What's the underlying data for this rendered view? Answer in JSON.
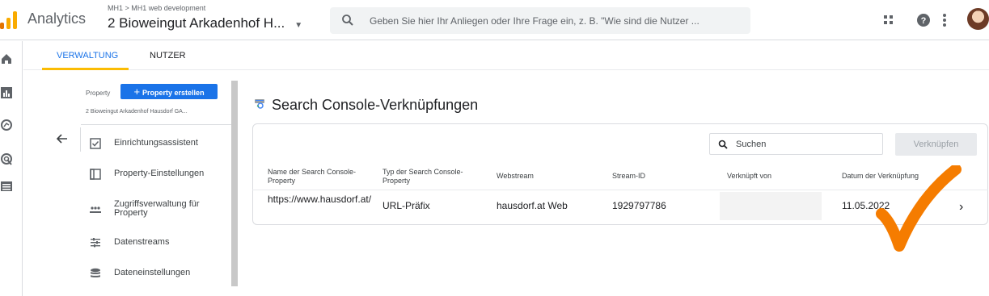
{
  "header": {
    "app_name": "Analytics",
    "breadcrumb": "MH1 > MH1 web development",
    "account_name": "2 Bioweingut Arkadenhof H...",
    "search_placeholder": "Geben Sie hier Ihr Anliegen oder Ihre Frage ein, z. B. \"Wie sind die Nutzer ..."
  },
  "tabs": [
    {
      "label": "VERWALTUNG",
      "active": true
    },
    {
      "label": "NUTZER",
      "active": false
    }
  ],
  "property_panel": {
    "label": "Property",
    "create_button": "Property erstellen",
    "property_name": "2 Bioweingut Arkadenhof Hausdorf GA...",
    "items": [
      {
        "label": "Einrichtungsassistent",
        "icon": "checkbox-icon"
      },
      {
        "label": "Property-Einstellungen",
        "icon": "settings-square-icon"
      },
      {
        "label": "Zugriffsverwaltung für Property",
        "icon": "people-icon"
      },
      {
        "label": "Datenstreams",
        "icon": "streams-icon"
      },
      {
        "label": "Dateneinstellungen",
        "icon": "database-icon"
      }
    ]
  },
  "main": {
    "title": "Search Console-Verknüpfungen",
    "search_placeholder": "Suchen",
    "link_button": "Verknüpfen",
    "columns": [
      "Name der Search Console-Property",
      "Typ der Search Console-Property",
      "Webstream",
      "Stream-ID",
      "Verknüpft von",
      "Datum der Verknüpfung"
    ],
    "rows": [
      {
        "property": "https://www.hausdorf.at/",
        "type": "URL-Präfix",
        "webstream": "hausdorf.at Web",
        "stream_id": "1929797786",
        "linked_by": "",
        "date": "11.05.2022"
      }
    ]
  },
  "colors": {
    "accent": "#1a73e8",
    "tab_underline": "#fbbc04",
    "checkmark": "#f57c00"
  }
}
